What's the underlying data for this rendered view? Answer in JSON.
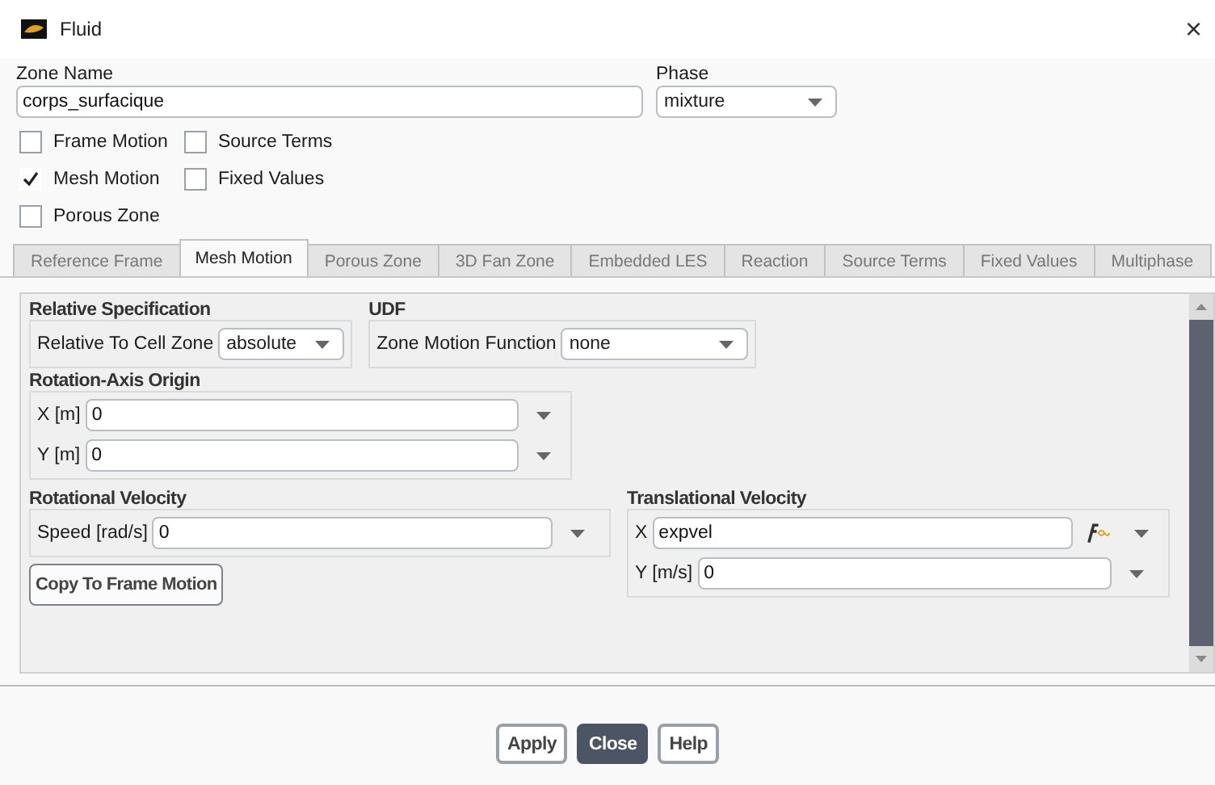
{
  "window": {
    "title": "Fluid",
    "close": "×"
  },
  "zone_name": {
    "label": "Zone Name",
    "value": "corps_surfacique"
  },
  "phase": {
    "label": "Phase",
    "value": "mixture"
  },
  "checkboxes": [
    {
      "label": "Frame Motion",
      "checked": false
    },
    {
      "label": "Source Terms",
      "checked": false
    },
    {
      "label": "Mesh Motion",
      "checked": true
    },
    {
      "label": "Fixed Values",
      "checked": false
    },
    {
      "label": "Porous Zone",
      "checked": false
    }
  ],
  "tabs": [
    {
      "label": "Reference Frame",
      "selected": false
    },
    {
      "label": "Mesh Motion",
      "selected": true
    },
    {
      "label": "Porous Zone",
      "selected": false
    },
    {
      "label": "3D Fan Zone",
      "selected": false
    },
    {
      "label": "Embedded LES",
      "selected": false
    },
    {
      "label": "Reaction",
      "selected": false
    },
    {
      "label": "Source Terms",
      "selected": false
    },
    {
      "label": "Fixed Values",
      "selected": false
    },
    {
      "label": "Multiphase",
      "selected": false
    }
  ],
  "relative_specification": {
    "title": "Relative Specification",
    "label": "Relative To Cell Zone",
    "value": "absolute"
  },
  "udf": {
    "title": "UDF",
    "label": "Zone Motion Function",
    "value": "none"
  },
  "rotation_axis_origin": {
    "title": "Rotation-Axis Origin",
    "fields": [
      {
        "label": "X [m]",
        "value": "0"
      },
      {
        "label": "Y [m]",
        "value": "0"
      }
    ]
  },
  "rotational_velocity": {
    "title": "Rotational Velocity",
    "fields": [
      {
        "label": "Speed [rad/s]",
        "value": "0"
      }
    ],
    "button": "Copy To Frame Motion"
  },
  "translational_velocity": {
    "title": "Translational Velocity",
    "fields": [
      {
        "label": "X",
        "value": "expvel",
        "kind": "expression"
      },
      {
        "label": "Y [m/s]",
        "value": "0",
        "kind": "number"
      }
    ]
  },
  "buttons": [
    {
      "label": "Apply",
      "primary": false
    },
    {
      "label": "Close",
      "primary": true
    },
    {
      "label": "Help",
      "primary": false
    }
  ]
}
